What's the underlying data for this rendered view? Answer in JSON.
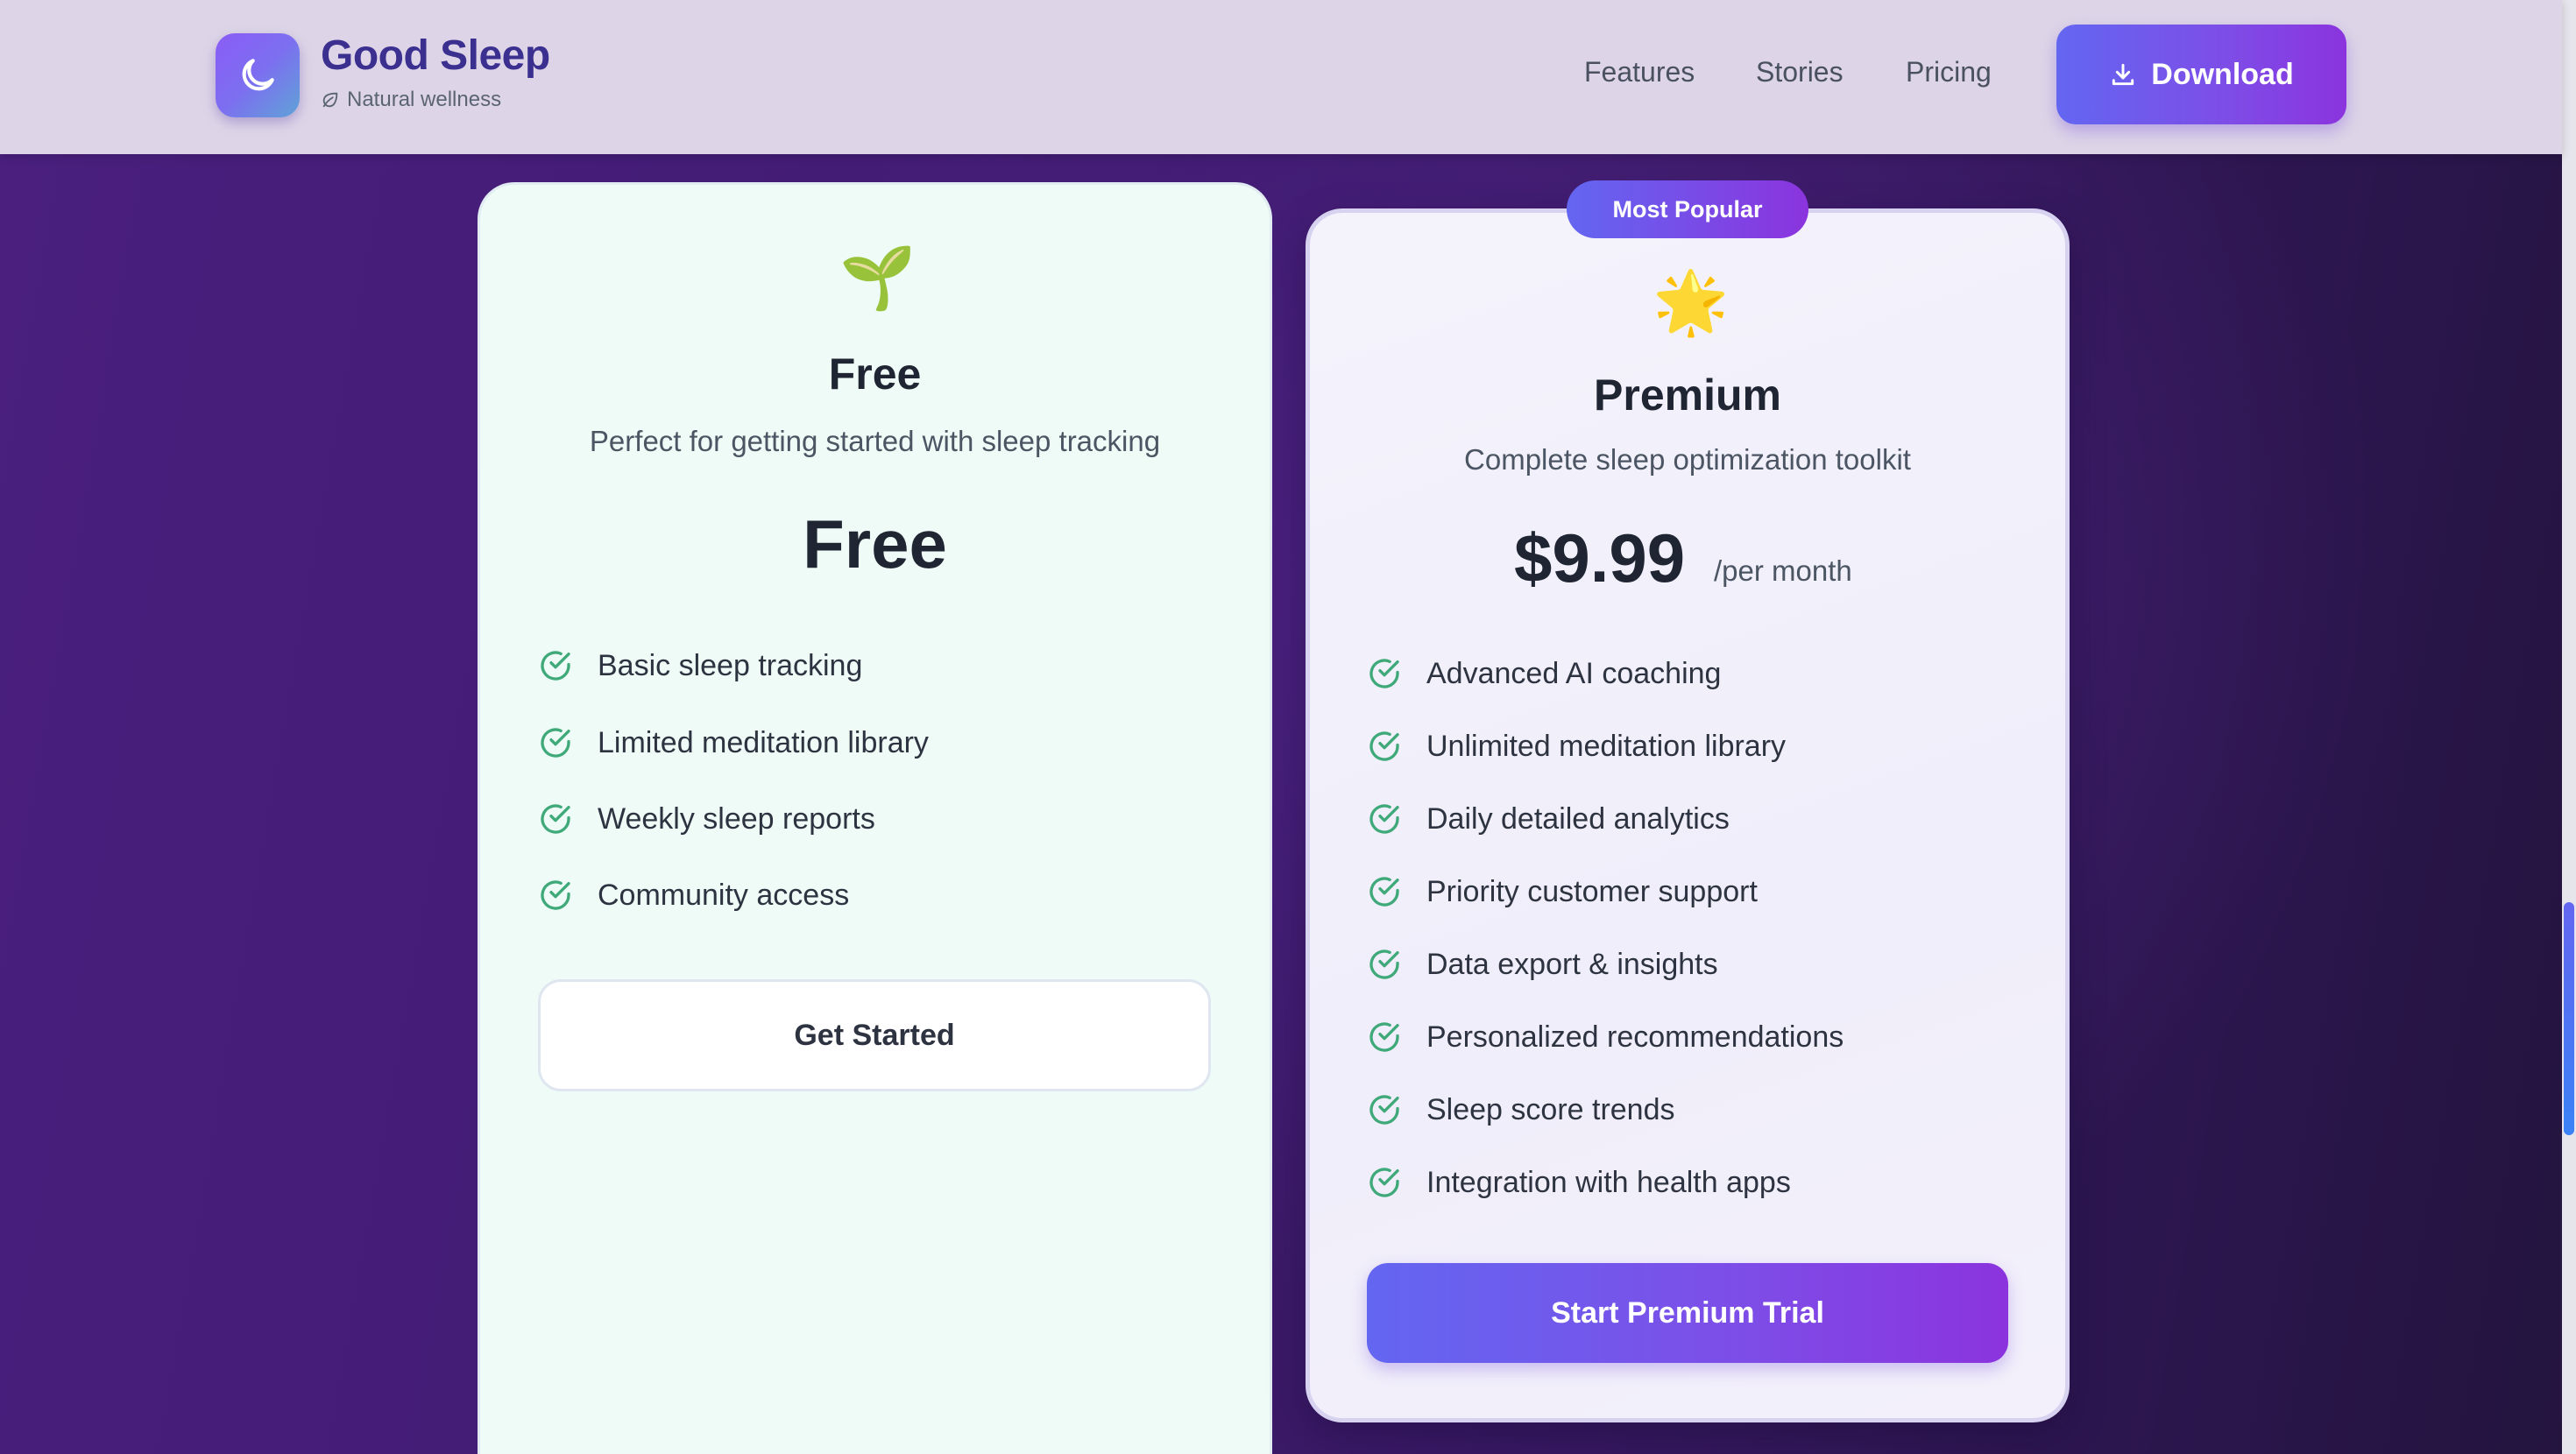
{
  "brand": {
    "name": "Good Sleep",
    "tagline": "Natural wellness",
    "logo_icon": "moon-icon",
    "tagline_icon": "leaf-icon"
  },
  "nav": {
    "items": [
      {
        "label": "Features"
      },
      {
        "label": "Stories"
      },
      {
        "label": "Pricing"
      }
    ],
    "download": {
      "label": "Download",
      "icon": "download-icon"
    }
  },
  "plans": {
    "free": {
      "emoji": "🌱",
      "name": "Free",
      "description": "Perfect for getting started with sleep tracking",
      "price": "Free",
      "features": [
        "Basic sleep tracking",
        "Limited meditation library",
        "Weekly sleep reports",
        "Community access"
      ],
      "cta": "Get Started"
    },
    "premium": {
      "badge": "Most Popular",
      "emoji": "🌟",
      "name": "Premium",
      "description": "Complete sleep optimization toolkit",
      "price": "$9.99",
      "period": "/per month",
      "features": [
        "Advanced AI coaching",
        "Unlimited meditation library",
        "Daily detailed analytics",
        "Priority customer support",
        "Data export & insights",
        "Personalized recommendations",
        "Sleep score trends",
        "Integration with health apps"
      ],
      "cta": "Start Premium Trial"
    }
  },
  "colors": {
    "accent_start": "#6366f1",
    "accent_end": "#8b34de",
    "check_green": "#3fa97a",
    "brand_text": "#3b2f8f"
  }
}
